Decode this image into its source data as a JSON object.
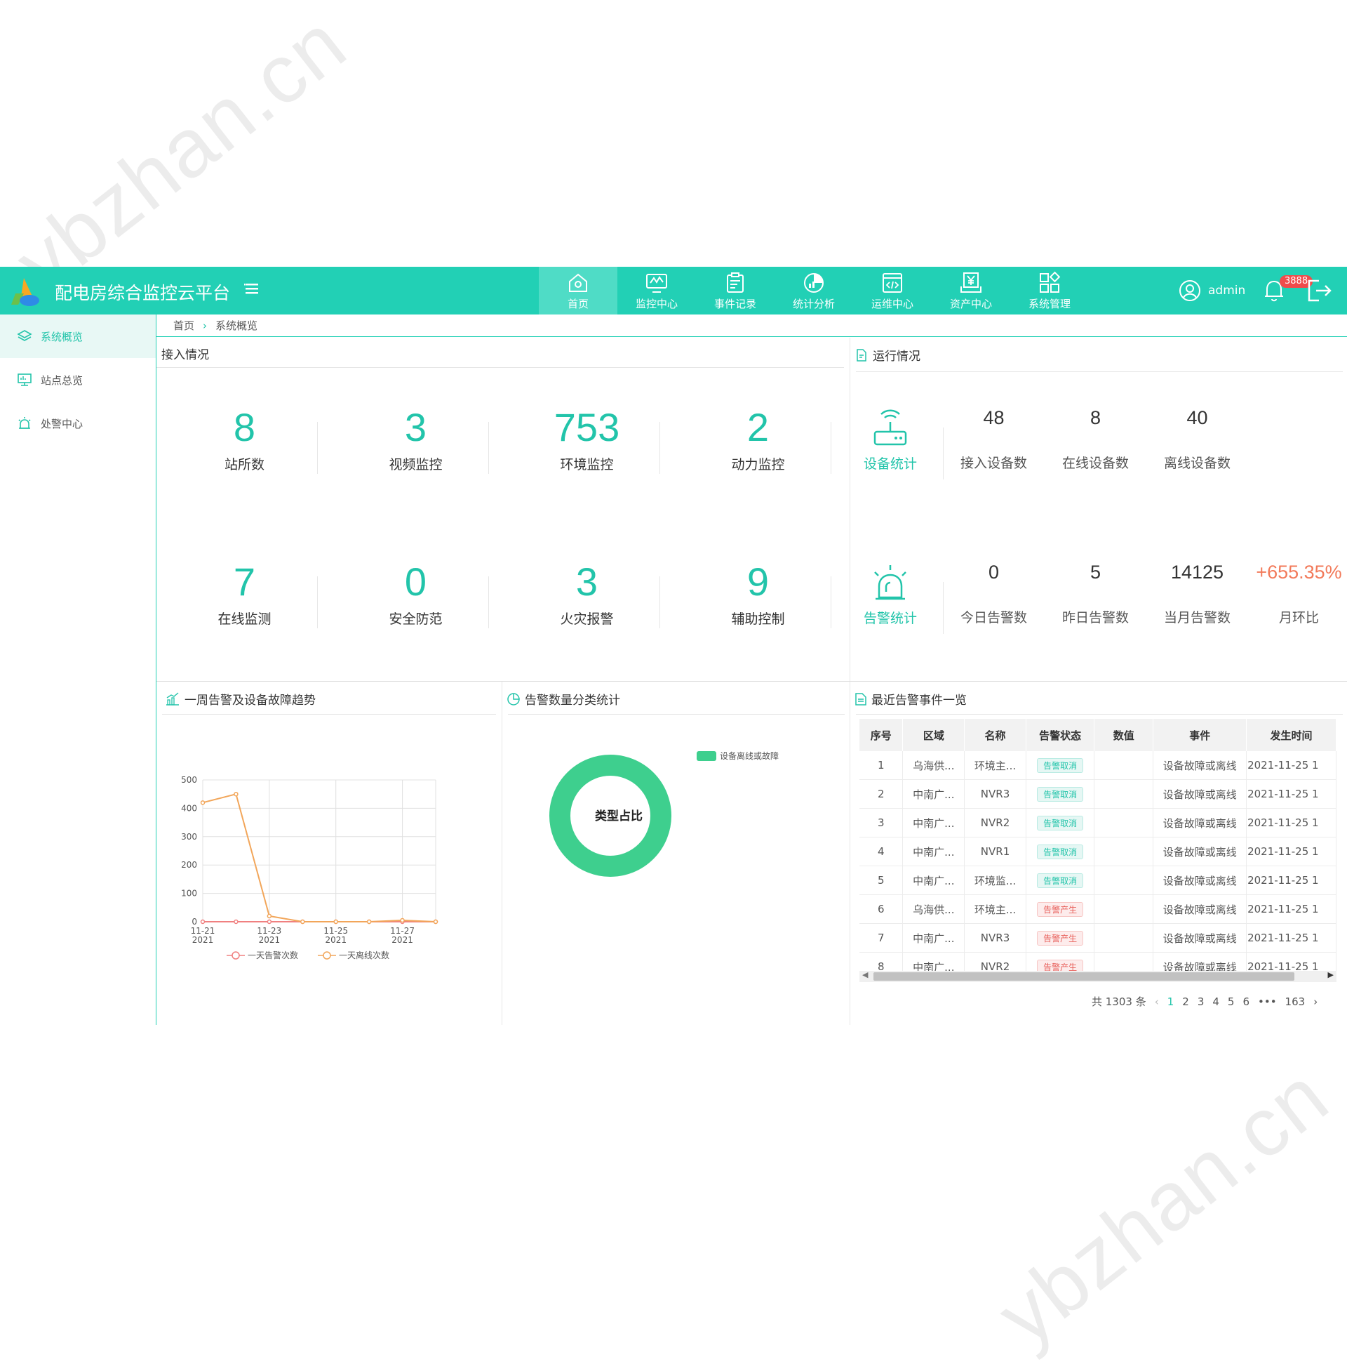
{
  "header": {
    "title": "配电房综合监控云平台",
    "nav": [
      {
        "label": "首页",
        "icon": "home-icon",
        "active": true
      },
      {
        "label": "监控中心",
        "icon": "monitor-icon"
      },
      {
        "label": "事件记录",
        "icon": "clipboard-icon"
      },
      {
        "label": "统计分析",
        "icon": "pie-icon"
      },
      {
        "label": "运维中心",
        "icon": "code-window-icon"
      },
      {
        "label": "资产中心",
        "icon": "asset-icon"
      },
      {
        "label": "系统管理",
        "icon": "grid-icon"
      }
    ],
    "user": "admin",
    "badge": "3888",
    "accent": "#22d0b5"
  },
  "sidebar": {
    "items": [
      {
        "label": "系统概览",
        "icon": "layers-icon",
        "active": true
      },
      {
        "label": "站点总览",
        "icon": "monitor-icon"
      },
      {
        "label": "处警中心",
        "icon": "alarm-icon"
      }
    ]
  },
  "breadcrumb": {
    "home": "首页",
    "current": "系统概览"
  },
  "access": {
    "title": "接入情况",
    "stats": [
      {
        "value": "8",
        "label": "站所数"
      },
      {
        "value": "3",
        "label": "视频监控"
      },
      {
        "value": "753",
        "label": "环境监控"
      },
      {
        "value": "2",
        "label": "动力监控"
      },
      {
        "value": "7",
        "label": "在线监测"
      },
      {
        "value": "0",
        "label": "安全防范"
      },
      {
        "value": "3",
        "label": "火灾报警"
      },
      {
        "value": "9",
        "label": "辅助控制"
      }
    ]
  },
  "running": {
    "title": "运行情况",
    "device": {
      "label": "设备统计",
      "items": [
        {
          "value": "48",
          "label": "接入设备数"
        },
        {
          "value": "8",
          "label": "在线设备数"
        },
        {
          "value": "40",
          "label": "离线设备数"
        }
      ]
    },
    "alarm": {
      "label": "告警统计",
      "items": [
        {
          "value": "0",
          "label": "今日告警数"
        },
        {
          "value": "5",
          "label": "昨日告警数"
        },
        {
          "value": "14125",
          "label": "当月告警数"
        },
        {
          "value": "+655.35%",
          "label": "月环比"
        }
      ]
    }
  },
  "trend": {
    "title": "一周告警及设备故障趋势"
  },
  "chart_data": [
    {
      "type": "line",
      "x": [
        "11-21\n2021",
        "11-22\n2021",
        "11-23\n2021",
        "11-24\n2021",
        "11-25\n2021",
        "11-26\n2021",
        "11-27\n2021",
        "11-28\n2021"
      ],
      "x_tick_labels": [
        [
          "11-21",
          "2021"
        ],
        [
          "11-23",
          "2021"
        ],
        [
          "11-25",
          "2021"
        ],
        [
          "11-27",
          "2021"
        ]
      ],
      "y_ticks": [
        "0",
        "100",
        "200",
        "300",
        "400",
        "500"
      ],
      "ylim": [
        0,
        500
      ],
      "series": [
        {
          "name": "一天告警次数",
          "values": [
            0,
            0,
            0,
            0,
            0,
            0,
            0,
            0
          ],
          "color": "#f08080"
        },
        {
          "name": "一天离线次数",
          "values": [
            420,
            450,
            20,
            0,
            0,
            0,
            5,
            0
          ],
          "color": "#f2a65a"
        }
      ],
      "grid": true,
      "legend": "bottom"
    },
    {
      "type": "pie",
      "title": "告警数量分类统计",
      "center_label": "类型占比",
      "slices": [
        {
          "name": "设备离线或故障",
          "value": 100,
          "color": "#3ecf8e"
        }
      ],
      "legend": "top-right"
    }
  ],
  "events": {
    "title": "最近告警事件一览",
    "columns": [
      "序号",
      "区域",
      "名称",
      "告警状态",
      "数值",
      "事件",
      "发生时间"
    ],
    "rows": [
      [
        "1",
        "乌海供...",
        "环境主...",
        "告警取消",
        "",
        "设备故障或离线",
        "2021-11-25 1"
      ],
      [
        "2",
        "中南广...",
        "NVR3",
        "告警取消",
        "",
        "设备故障或离线",
        "2021-11-25 1"
      ],
      [
        "3",
        "中南广...",
        "NVR2",
        "告警取消",
        "",
        "设备故障或离线",
        "2021-11-25 1"
      ],
      [
        "4",
        "中南广...",
        "NVR1",
        "告警取消",
        "",
        "设备故障或离线",
        "2021-11-25 1"
      ],
      [
        "5",
        "中南广...",
        "环境监...",
        "告警取消",
        "",
        "设备故障或离线",
        "2021-11-25 1"
      ],
      [
        "6",
        "乌海供...",
        "环境主...",
        "告警产生",
        "",
        "设备故障或离线",
        "2021-11-25 1"
      ],
      [
        "7",
        "中南广...",
        "NVR3",
        "告警产生",
        "",
        "设备故障或离线",
        "2021-11-25 1"
      ],
      [
        "8",
        "中南广...",
        "NVR2",
        "告警产生",
        "",
        "设备故障或离线",
        "2021-11-25 1"
      ]
    ],
    "pager": {
      "total": "共 1303 条",
      "pages": [
        "1",
        "2",
        "3",
        "4",
        "5",
        "6",
        "•••",
        "163"
      ],
      "current": "1"
    }
  },
  "watermark": "ybzhan.cn"
}
